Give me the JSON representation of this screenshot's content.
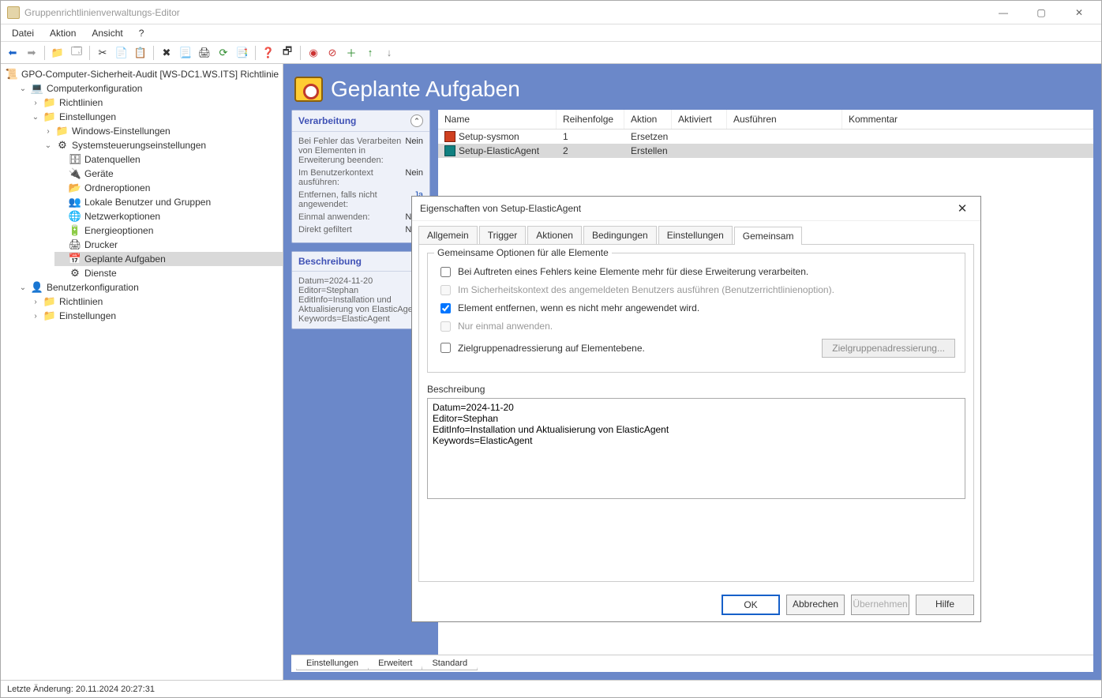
{
  "window_title": "Gruppenrichtlinienverwaltungs-Editor",
  "menu": {
    "file": "Datei",
    "action": "Aktion",
    "view": "Ansicht",
    "help": "?"
  },
  "tree": {
    "root": "GPO-Computer-Sicherheit-Audit [WS-DC1.WS.ITS] Richtlinie",
    "computer_config": "Computerkonfiguration",
    "richtlinien": "Richtlinien",
    "einstellungen": "Einstellungen",
    "windows_einst": "Windows-Einstellungen",
    "sys_einst": "Systemsteuerungseinstellungen",
    "datenquellen": "Datenquellen",
    "geraete": "Geräte",
    "ordneroptionen": "Ordneroptionen",
    "lokale_benutzer": "Lokale Benutzer und Gruppen",
    "netzwerkoptionen": "Netzwerkoptionen",
    "energieoptionen": "Energieoptionen",
    "drucker": "Drucker",
    "geplante_aufgaben": "Geplante Aufgaben",
    "dienste": "Dienste",
    "benutzer_config": "Benutzerkonfiguration",
    "benutzer_richtlinien": "Richtlinien",
    "benutzer_einstellungen": "Einstellungen"
  },
  "main": {
    "title": "Geplante Aufgaben",
    "processing_header": "Verarbeitung",
    "proc_stop": "Bei Fehler das Verarbeiten von Elementen in Erweiterung beenden:",
    "proc_stop_v": "Nein",
    "proc_ctx": "Im Benutzerkontext ausführen:",
    "proc_ctx_v": "Nein",
    "proc_remove": "Entfernen, falls nicht angewendet:",
    "proc_remove_v": "Ja",
    "proc_once": "Einmal anwenden:",
    "proc_once_v": "Nein",
    "proc_filter": "Direkt gefiltert",
    "proc_filter_v": "Nein",
    "desc_header": "Beschreibung",
    "desc_body": "Datum=2024-11-20\nEditor=Stephan\nEditInfo=Installation und Aktualisierung von ElasticAgent\nKeywords=ElasticAgent",
    "columns": {
      "name": "Name",
      "order": "Reihenfolge",
      "action": "Aktion",
      "active": "Aktiviert",
      "exec": "Ausführen",
      "comment": "Kommentar"
    },
    "rows": [
      {
        "name": "Setup-sysmon",
        "order": "1",
        "action": "Ersetzen"
      },
      {
        "name": "Setup-ElasticAgent",
        "order": "2",
        "action": "Erstellen"
      }
    ]
  },
  "bottom_tabs": {
    "t1": "Einstellungen",
    "t2": "Erweitert",
    "t3": "Standard"
  },
  "statusbar": "Letzte Änderung: 20.11.2024 20:27:31",
  "dialog": {
    "title": "Eigenschaften von Setup-ElasticAgent",
    "tabs": {
      "allgemein": "Allgemein",
      "trigger": "Trigger",
      "aktionen": "Aktionen",
      "bedingungen": "Bedingungen",
      "einstellungen": "Einstellungen",
      "gemeinsam": "Gemeinsam"
    },
    "fieldset_title": "Gemeinsame Optionen für alle Elemente",
    "opt_stop": "Bei Auftreten eines Fehlers keine Elemente mehr für diese Erweiterung verarbeiten.",
    "opt_ctx": "Im Sicherheitskontext des angemeldeten Benutzers ausführen (Benutzerrichtlinienoption).",
    "opt_remove": "Element entfernen, wenn es nicht mehr angewendet wird.",
    "opt_once": "Nur einmal anwenden.",
    "opt_target": "Zielgruppenadressierung auf Elementebene.",
    "btn_targeting": "Zielgruppenadressierung...",
    "desc_label": "Beschreibung",
    "desc_value": "Datum=2024-11-20\nEditor=Stephan\nEditInfo=Installation und Aktualisierung von ElasticAgent\nKeywords=ElasticAgent",
    "btn_ok": "OK",
    "btn_cancel": "Abbrechen",
    "btn_apply": "Übernehmen",
    "btn_help": "Hilfe"
  }
}
